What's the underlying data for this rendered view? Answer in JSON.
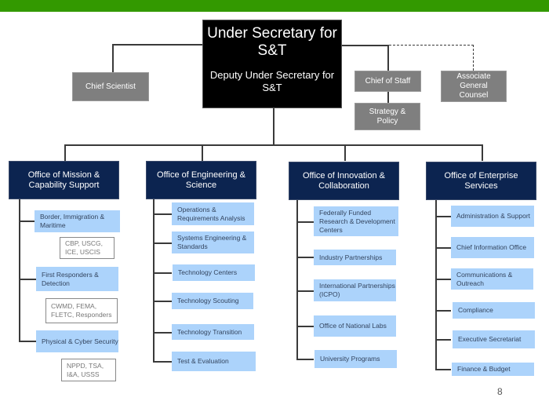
{
  "colors": {
    "header_bar": "#339900",
    "executive": "#000000",
    "staff": "#7f7f7f",
    "office": "#0c2450",
    "unit": "#acd3fb",
    "unit_text": "#33445e"
  },
  "executive": {
    "title": "Under Secretary for S&T",
    "deputy": "Deputy Under Secretary for S&T"
  },
  "staff": {
    "chief_scientist": "Chief Scientist",
    "chief_of_staff": "Chief of Staff",
    "strategy_policy": "Strategy & Policy",
    "general_counsel": "Associate General Counsel"
  },
  "offices": [
    {
      "name": "Office of Mission & Capability Support",
      "units": [
        {
          "name": "Border, Immigration & Maritime",
          "components": "CBP, USCG, ICE, USCIS"
        },
        {
          "name": "First Responders & Detection",
          "components": "CWMD, FEMA, FLETC, Responders"
        },
        {
          "name": "Physical & Cyber Security",
          "components": "NPPD, TSA, I&A, USSS"
        }
      ]
    },
    {
      "name": "Office of Engineering & Science",
      "units": [
        {
          "name": "Operations & Requirements Analysis"
        },
        {
          "name": "Systems Engineering & Standards"
        },
        {
          "name": "Technology Centers"
        },
        {
          "name": "Technology Scouting"
        },
        {
          "name": "Technology Transition"
        },
        {
          "name": "Test & Evaluation"
        }
      ]
    },
    {
      "name": "Office of Innovation & Collaboration",
      "units": [
        {
          "name": "Federally Funded Research & Development Centers"
        },
        {
          "name": "Industry Partnerships"
        },
        {
          "name": "International Partnerships (ICPO)"
        },
        {
          "name": "Office of National Labs"
        },
        {
          "name": "University Programs"
        }
      ]
    },
    {
      "name": "Office of Enterprise Services",
      "units": [
        {
          "name": "Administration & Support"
        },
        {
          "name": "Chief Information Office"
        },
        {
          "name": "Communications & Outreach"
        },
        {
          "name": "Compliance"
        },
        {
          "name": "Executive Secretariat"
        },
        {
          "name": "Finance & Budget"
        }
      ]
    }
  ],
  "page_number": "8"
}
